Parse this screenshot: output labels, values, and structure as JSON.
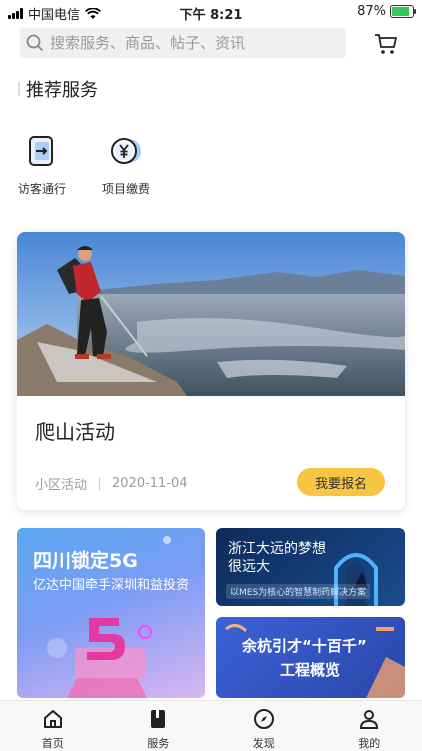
{
  "status_bar": {
    "carrier": "中国电信",
    "time": "下午 8:21",
    "battery": "87%",
    "battery_level": 0.87
  },
  "search": {
    "placeholder": "搜索服务、商品、帖子、资讯"
  },
  "section": {
    "title": "推荐服务"
  },
  "services": [
    {
      "label": "访客通行",
      "icon": "door-pass-icon"
    },
    {
      "label": "项目缴费",
      "icon": "yuan-coin-icon"
    }
  ],
  "activity": {
    "title": "爬山活动",
    "category": "小区活动",
    "date": "2020-11-04",
    "signup_label": "我要报名"
  },
  "banners": {
    "b1": {
      "title": "四川锁定5G",
      "subtitle": "亿达中国牵手深圳和益投资"
    },
    "b2": {
      "title": "浙江大远的梦想很远大",
      "tag": "以MES为核心的智慧制药解决方案"
    },
    "b3": {
      "line1": "余杭引才“十百千”",
      "line2": "工程概览"
    }
  },
  "tabs": [
    {
      "label": "首页",
      "icon": "home-icon"
    },
    {
      "label": "服务",
      "icon": "book-icon"
    },
    {
      "label": "发现",
      "icon": "compass-icon"
    },
    {
      "label": "我的",
      "icon": "user-icon"
    }
  ],
  "colors": {
    "accent": "#f8c543",
    "search_bg": "#f0f0f0",
    "icon_blue": "#3b8ff0"
  }
}
